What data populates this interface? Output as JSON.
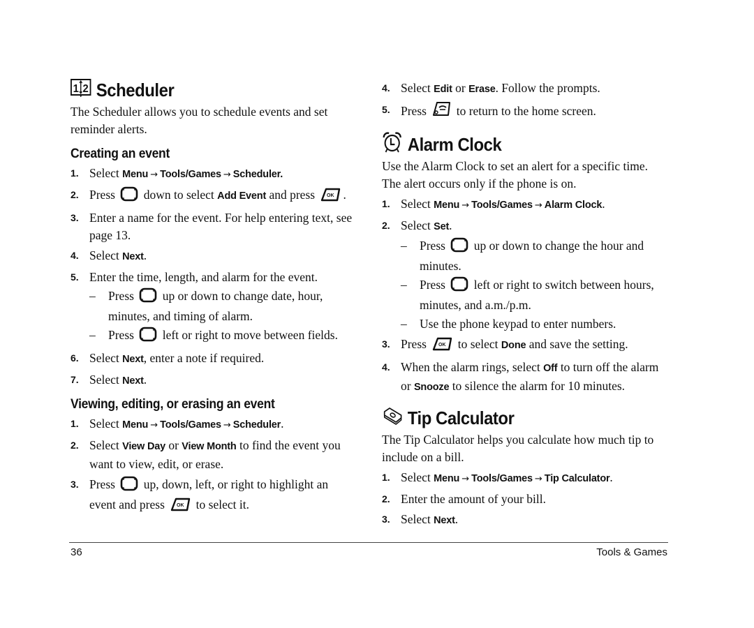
{
  "left_column": {
    "scheduler": {
      "icon": "scheduler-book-icon",
      "title": "Scheduler",
      "intro": "The Scheduler allows you to schedule events and set reminder alerts.",
      "creating": {
        "heading": "Creating an event",
        "steps": [
          {
            "num": "1.",
            "parts": [
              "Select ",
              {
                "b": "Menu"
              },
              {
                "arrow": "→"
              },
              {
                "b": "Tools/Games"
              },
              {
                "arrow": "→"
              },
              {
                "b": "Scheduler."
              }
            ]
          },
          {
            "num": "2.",
            "parts": [
              "Press ",
              {
                "key": "nav-key-icon"
              },
              " down to select ",
              {
                "b": "Add Event"
              },
              " and press ",
              {
                "key": "ok-key-icon"
              },
              "."
            ]
          },
          {
            "num": "3.",
            "parts": [
              "Enter a name for the event. For help entering text, see page 13."
            ]
          },
          {
            "num": "4.",
            "parts": [
              "Select ",
              {
                "b": "Next"
              },
              "."
            ]
          },
          {
            "num": "5.",
            "parts": [
              "Enter the time, length, and alarm for the event."
            ],
            "subs": [
              {
                "parts": [
                  "Press ",
                  {
                    "key": "nav-key-icon"
                  },
                  " up or down to change date, hour, minutes, and timing of alarm."
                ]
              },
              {
                "parts": [
                  "Press ",
                  {
                    "key": "nav-key-icon"
                  },
                  " left or right to move between fields."
                ]
              }
            ]
          },
          {
            "num": "6.",
            "parts": [
              "Select ",
              {
                "b": "Next"
              },
              ", enter a note if required."
            ]
          },
          {
            "num": "7.",
            "parts": [
              "Select ",
              {
                "b": "Next"
              },
              "."
            ]
          }
        ]
      },
      "viewing": {
        "heading": "Viewing, editing, or erasing an event",
        "steps": [
          {
            "num": "1.",
            "parts": [
              "Select ",
              {
                "b": "Menu"
              },
              {
                "arrow": "→"
              },
              {
                "b": "Tools/Games"
              },
              {
                "arrow": "→"
              },
              {
                "b": "Scheduler"
              },
              "."
            ]
          },
          {
            "num": "2.",
            "parts": [
              "Select ",
              {
                "b": "View Day"
              },
              " or ",
              {
                "b": "View Month"
              },
              " to find the event you want to view, edit, or erase."
            ]
          },
          {
            "num": "3.",
            "parts": [
              "Press ",
              {
                "key": "nav-key-icon"
              },
              " up, down, left, or right to highlight an event and press ",
              {
                "key": "ok-key-icon"
              },
              " to select it."
            ]
          }
        ]
      }
    }
  },
  "right_column": {
    "viewing_continued": {
      "steps": [
        {
          "num": "4.",
          "parts": [
            "Select ",
            {
              "b": "Edit"
            },
            " or ",
            {
              "b": "Erase"
            },
            ". Follow the prompts."
          ]
        },
        {
          "num": "5.",
          "parts": [
            "Press ",
            {
              "key": "end-key-icon"
            },
            " to return to the home screen."
          ]
        }
      ]
    },
    "alarm_clock": {
      "icon": "alarm-clock-icon",
      "title": "Alarm Clock",
      "intro": "Use the Alarm Clock to set an alert for a specific time. The alert occurs only if the phone is on.",
      "steps": [
        {
          "num": "1.",
          "parts": [
            "Select ",
            {
              "b": "Menu"
            },
            {
              "arrow": "→"
            },
            {
              "b": "Tools/Games"
            },
            {
              "arrow": "→"
            },
            {
              "b": "Alarm Clock"
            },
            "."
          ]
        },
        {
          "num": "2.",
          "parts": [
            "Select ",
            {
              "b": "Set"
            },
            "."
          ],
          "subs": [
            {
              "parts": [
                "Press ",
                {
                  "key": "nav-key-icon"
                },
                " up or down to change the hour and minutes."
              ]
            },
            {
              "parts": [
                "Press ",
                {
                  "key": "nav-key-icon"
                },
                " left or right to switch between hours, minutes, and a.m./p.m."
              ]
            },
            {
              "parts": [
                "Use the phone keypad to enter numbers."
              ]
            }
          ]
        },
        {
          "num": "3.",
          "parts": [
            "Press ",
            {
              "key": "ok-key-icon"
            },
            " to select ",
            {
              "b": "Done"
            },
            " and save the setting."
          ]
        },
        {
          "num": "4.",
          "parts": [
            "When the alarm rings, select ",
            {
              "b": "Off"
            },
            " to turn off the alarm or ",
            {
              "b": "Snooze"
            },
            " to silence the alarm for 10 minutes."
          ]
        }
      ]
    },
    "tip_calculator": {
      "icon": "tip-calculator-bill-icon",
      "title": "Tip Calculator",
      "intro": "The Tip Calculator helps you calculate how much tip to include on a bill.",
      "steps": [
        {
          "num": "1.",
          "parts": [
            "Select ",
            {
              "b": "Menu"
            },
            {
              "arrow": "→"
            },
            {
              "b": "Tools/Games"
            },
            {
              "arrow": "→"
            },
            {
              "b": "Tip Calculator"
            },
            "."
          ]
        },
        {
          "num": "2.",
          "parts": [
            "Enter the amount of your bill."
          ]
        },
        {
          "num": "3.",
          "parts": [
            "Select ",
            {
              "b": "Next"
            },
            "."
          ]
        }
      ]
    }
  },
  "footer": {
    "page_number": "36",
    "section": "Tools & Games"
  }
}
